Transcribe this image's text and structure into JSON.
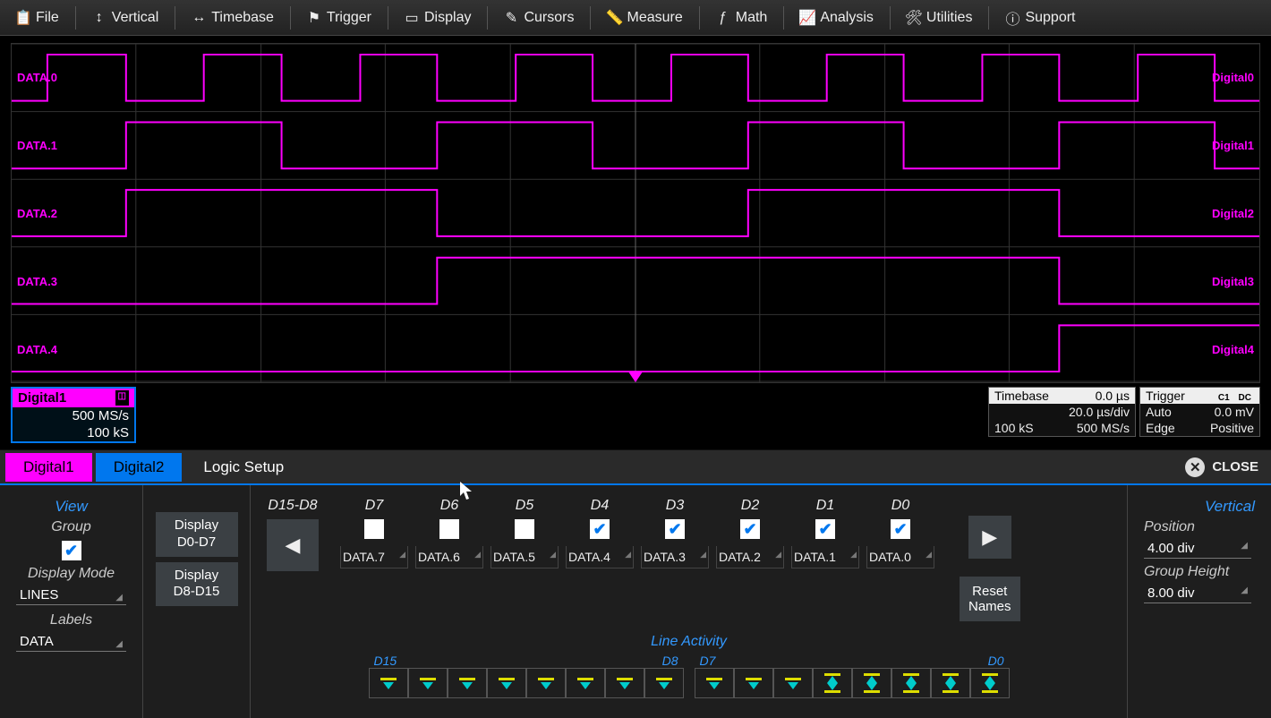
{
  "menubar": [
    {
      "icon": "clipboard",
      "label": "File"
    },
    {
      "icon": "vert-arrows",
      "label": "Vertical"
    },
    {
      "icon": "horiz-arrows",
      "label": "Timebase"
    },
    {
      "icon": "flag",
      "label": "Trigger"
    },
    {
      "icon": "display",
      "label": "Display"
    },
    {
      "icon": "cursors",
      "label": "Cursors"
    },
    {
      "icon": "measure",
      "label": "Measure"
    },
    {
      "icon": "math",
      "label": "Math"
    },
    {
      "icon": "analysis",
      "label": "Analysis"
    },
    {
      "icon": "wrench",
      "label": "Utilities"
    },
    {
      "icon": "info",
      "label": "Support"
    }
  ],
  "channels": [
    {
      "left": "DATA.0",
      "right": "Digital0"
    },
    {
      "left": "DATA.1",
      "right": "Digital1"
    },
    {
      "left": "DATA.2",
      "right": "Digital2"
    },
    {
      "left": "DATA.3",
      "right": "Digital3"
    },
    {
      "left": "DATA.4",
      "right": "Digital4"
    }
  ],
  "info_left": {
    "title": "Digital1",
    "rate": "500 MS/s",
    "samples": "100 kS"
  },
  "timebase": {
    "title": "Timebase",
    "offset": "0.0 µs",
    "perdiv": "20.0 µs/div",
    "samples": "100 kS",
    "rate": "500 MS/s"
  },
  "trigger": {
    "title": "Trigger",
    "badge1": "C1",
    "badge2": "DC",
    "mode": "Auto",
    "level": "0.0 mV",
    "type": "Edge",
    "slope": "Positive"
  },
  "tabs": {
    "digital1": "Digital1",
    "digital2": "Digital2",
    "logic": "Logic Setup",
    "close": "CLOSE"
  },
  "view": {
    "title": "View",
    "group": "Group",
    "display_mode": "Display Mode",
    "lines": "LINES",
    "labels_lbl": "Labels",
    "labels_val": "DATA"
  },
  "dispbtn": {
    "a": "Display D0-D7",
    "b": "Display D8-D15"
  },
  "page_label": "D15-D8",
  "bit_columns": [
    {
      "h": "D7",
      "name": "DATA.7",
      "checked": false
    },
    {
      "h": "D6",
      "name": "DATA.6",
      "checked": false
    },
    {
      "h": "D5",
      "name": "DATA.5",
      "checked": false
    },
    {
      "h": "D4",
      "name": "DATA.4",
      "checked": true
    },
    {
      "h": "D3",
      "name": "DATA.3",
      "checked": true
    },
    {
      "h": "D2",
      "name": "DATA.2",
      "checked": true
    },
    {
      "h": "D1",
      "name": "DATA.1",
      "checked": true
    },
    {
      "h": "D0",
      "name": "DATA.0",
      "checked": true
    }
  ],
  "reset": "Reset Names",
  "lineact": {
    "title": "Line Activity",
    "left_hi": "D15",
    "left_lo": "D8",
    "right_hi": "D7",
    "right_lo": "D0"
  },
  "line_activity": {
    "left": [
      "dn",
      "dn",
      "dn",
      "dn",
      "dn",
      "dn",
      "dn",
      "dn"
    ],
    "right": [
      "dn",
      "dn",
      "dn",
      "both",
      "both",
      "both",
      "both",
      "both"
    ]
  },
  "vertical": {
    "title": "Vertical",
    "pos_lbl": "Position",
    "pos_val": "4.00 div",
    "gh_lbl": "Group Height",
    "gh_val": "8.00 div"
  }
}
